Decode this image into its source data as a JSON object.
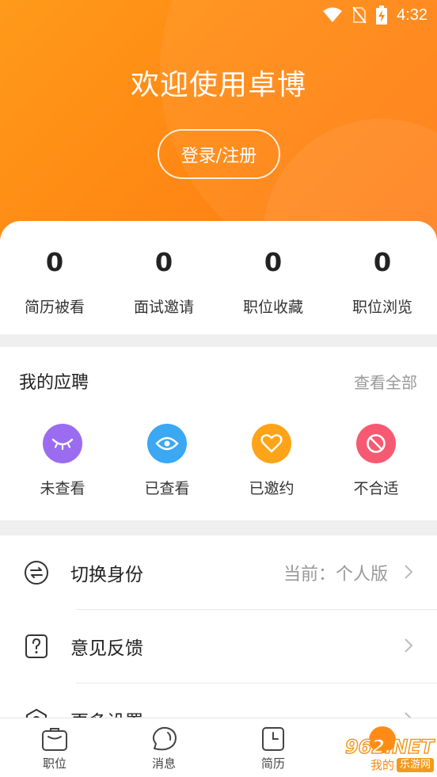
{
  "status_bar": {
    "time": "4:32"
  },
  "header": {
    "welcome": "欢迎使用卓博",
    "login_button": "登录/注册"
  },
  "stats": [
    {
      "value": "0",
      "label": "简历被看"
    },
    {
      "value": "0",
      "label": "面试邀请"
    },
    {
      "value": "0",
      "label": "职位收藏"
    },
    {
      "value": "0",
      "label": "职位浏览"
    }
  ],
  "my_applications": {
    "title": "我的应聘",
    "view_all": "查看全部",
    "items": [
      {
        "label": "未查看",
        "icon": "closed-eye-icon",
        "color": "#9b6cf0"
      },
      {
        "label": "已查看",
        "icon": "eye-icon",
        "color": "#3aa8f2"
      },
      {
        "label": "已邀约",
        "icon": "heart-icon",
        "color": "#ffa418"
      },
      {
        "label": "不合适",
        "icon": "forbidden-icon",
        "color": "#f65a72"
      }
    ]
  },
  "menu": [
    {
      "label": "切换身份",
      "value": "当前：个人版",
      "icon": "switch-icon"
    },
    {
      "label": "意见反馈",
      "value": "",
      "icon": "question-icon"
    },
    {
      "label": "更多设置",
      "value": "",
      "icon": "settings-icon"
    }
  ],
  "tabbar": [
    {
      "label": "职位",
      "icon": "briefcase-icon"
    },
    {
      "label": "消息",
      "icon": "message-icon"
    },
    {
      "label": "简历",
      "icon": "resume-icon"
    },
    {
      "label": "我的",
      "icon": "profile-icon"
    }
  ],
  "watermark": {
    "line1": "962.NET",
    "line2": "乐游网"
  },
  "colors": {
    "accent": "#ff8a14",
    "header_start": "#ff9a1a",
    "header_end": "#ff7a12"
  }
}
